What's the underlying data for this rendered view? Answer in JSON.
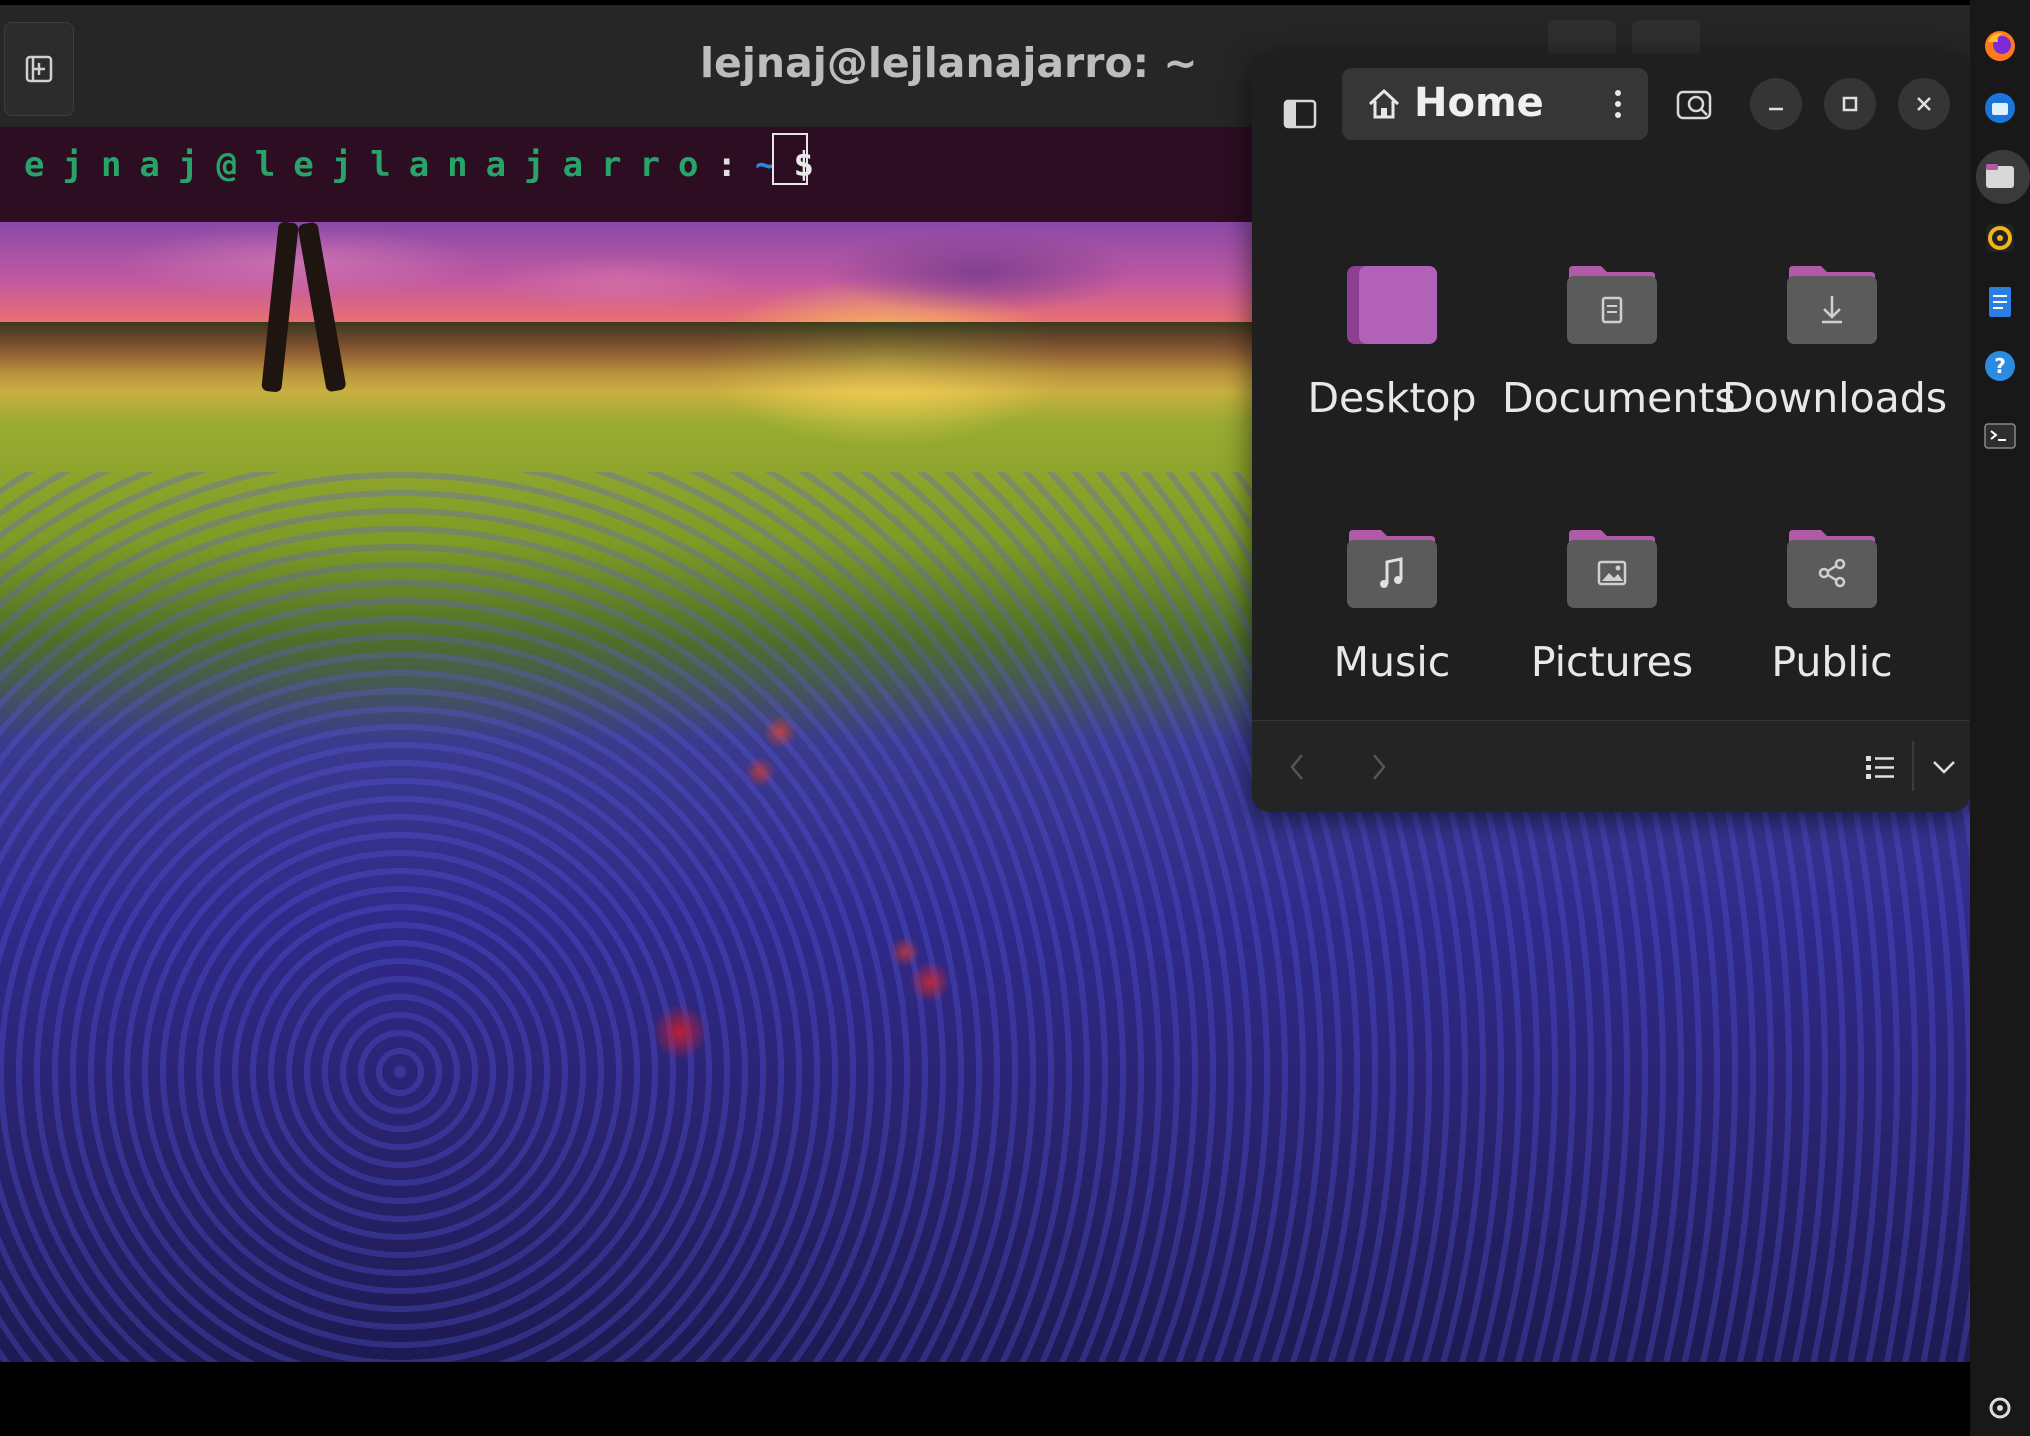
{
  "terminal": {
    "title": "lejnaj@lejlanajarro: ~",
    "prompt": {
      "user_host": "ejnaj@lejlanajarro",
      "colon": ":",
      "path": "~",
      "symbol": "$"
    },
    "colors": {
      "header_bg": "#262626",
      "body_bg": "#2c0d22",
      "user_host": "#28a36a",
      "path": "#2f86d8"
    }
  },
  "file_manager": {
    "location": "Home",
    "items": [
      {
        "label": "Desktop",
        "icon": "desktop-folder-icon"
      },
      {
        "label": "Documents",
        "icon": "documents-folder-icon"
      },
      {
        "label": "Downloads",
        "icon": "downloads-folder-icon"
      },
      {
        "label": "Music",
        "icon": "music-folder-icon"
      },
      {
        "label": "Pictures",
        "icon": "pictures-folder-icon"
      },
      {
        "label": "Public",
        "icon": "public-folder-icon"
      }
    ],
    "colors": {
      "folder_tab": "#b15aa8",
      "folder_body": "#5b5b5b",
      "desktop_folder": "#9e48a0"
    }
  },
  "dock": {
    "apps": [
      "firefox-icon",
      "thunderbird-icon",
      "files-icon",
      "rhythmbox-icon",
      "writer-icon",
      "help-icon",
      "terminal-icon",
      "settings-icon"
    ]
  }
}
